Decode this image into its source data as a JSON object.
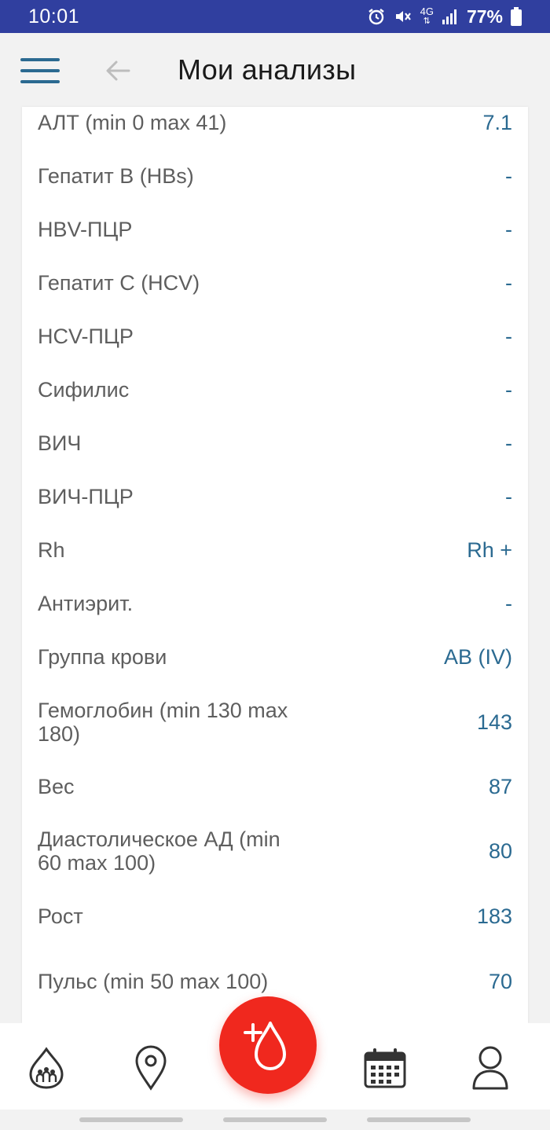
{
  "status_bar": {
    "time": "10:01",
    "network": "4G",
    "battery": "77%",
    "icons": [
      "alarm-icon",
      "mute-vibrate-icon",
      "4g-data-icon",
      "signal-icon",
      "battery-icon"
    ]
  },
  "header": {
    "title": "Мои анализы",
    "menu_icon": "hamburger-menu-icon",
    "back_icon": "back-arrow-icon"
  },
  "results": [
    {
      "label": "АЛТ (min 0 max 41)",
      "value": "7.1"
    },
    {
      "label": "Гепатит B (HBs)",
      "value": "-"
    },
    {
      "label": "HBV-ПЦР",
      "value": "-"
    },
    {
      "label": "Гепатит C (HCV)",
      "value": "-"
    },
    {
      "label": "HCV-ПЦР",
      "value": "-"
    },
    {
      "label": "Сифилис",
      "value": "-"
    },
    {
      "label": "ВИЧ",
      "value": "-"
    },
    {
      "label": "ВИЧ-ПЦР",
      "value": "-"
    },
    {
      "label": "Rh",
      "value": "Rh +"
    },
    {
      "label": "Антиэрит.",
      "value": "-"
    },
    {
      "label": "Группа крови",
      "value": "AB (IV)"
    },
    {
      "label": "Гемоглобин (min 130 max 180)",
      "value": "143"
    },
    {
      "label": "Вес",
      "value": "87"
    },
    {
      "label": "Диастолическое АД (min 60 max 100)",
      "value": "80"
    },
    {
      "label": "Рост",
      "value": "183"
    },
    {
      "label": "Пульс (min 50 max 100)",
      "value": "70"
    }
  ],
  "bottom_nav": {
    "items": [
      "donor-community-icon",
      "map-pin-icon",
      "add-donation-icon",
      "calendar-icon",
      "profile-icon"
    ]
  },
  "colors": {
    "status_bar": "#303f9f",
    "accent": "#2b6a91",
    "fab": "#f0281e",
    "menu_icon": "#2b6a91"
  }
}
